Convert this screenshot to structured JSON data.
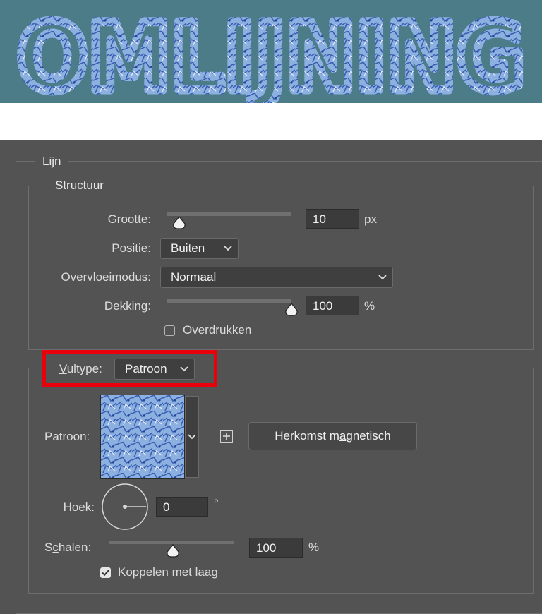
{
  "banner": {
    "text": "OMLIJNING",
    "bg_color": "#4b7c88",
    "pattern_color": "#7ea3d8"
  },
  "lijn": {
    "legend": "Lijn",
    "structuur": {
      "legend": "Structuur",
      "grootte": {
        "label_u": "G",
        "label_rest": "rootte:",
        "value": "10",
        "unit": "px",
        "slider_fraction": 0.07
      },
      "positie": {
        "label_u": "P",
        "label_rest": "ositie:",
        "value": "Buiten"
      },
      "overvloeimodus": {
        "label_u": "O",
        "label_rest": "vervloeimodus:",
        "value": "Normaal"
      },
      "dekking": {
        "label_u": "D",
        "label_rest": "ekking:",
        "value": "100",
        "unit": "%",
        "slider_fraction": 1.0
      },
      "overdrukken": {
        "label": "Overdrukken",
        "checked": false
      }
    },
    "vulling": {
      "vultype": {
        "label_u": "V",
        "label_rest": "ultype:",
        "value": "Patroon"
      },
      "patroon": {
        "label": "Patroon:",
        "snap_label_before": "Herkomst m",
        "snap_label_u": "a",
        "snap_label_after": "gnetisch"
      },
      "hoek": {
        "label_before": "Hoe",
        "label_u": "k",
        "label_after": ":",
        "value": "0",
        "unit": "°"
      },
      "schalen": {
        "label_before": "S",
        "label_u": "c",
        "label_after": "halen:",
        "value": "100",
        "unit": "%",
        "slider_fraction": 0.51
      },
      "koppelen": {
        "label_u": "K",
        "label_rest": "oppelen met laag",
        "checked": true
      }
    }
  },
  "colors": {
    "highlight": "#e8000a",
    "panel_bg": "#535353",
    "field_bg": "#3b3b3b"
  },
  "icons": {
    "chevron": "chevron-down-icon",
    "plus": "plus-box-icon",
    "angle": "angle-dial-icon",
    "thumb": "slider-thumb-icon",
    "check": "checkmark-icon"
  }
}
